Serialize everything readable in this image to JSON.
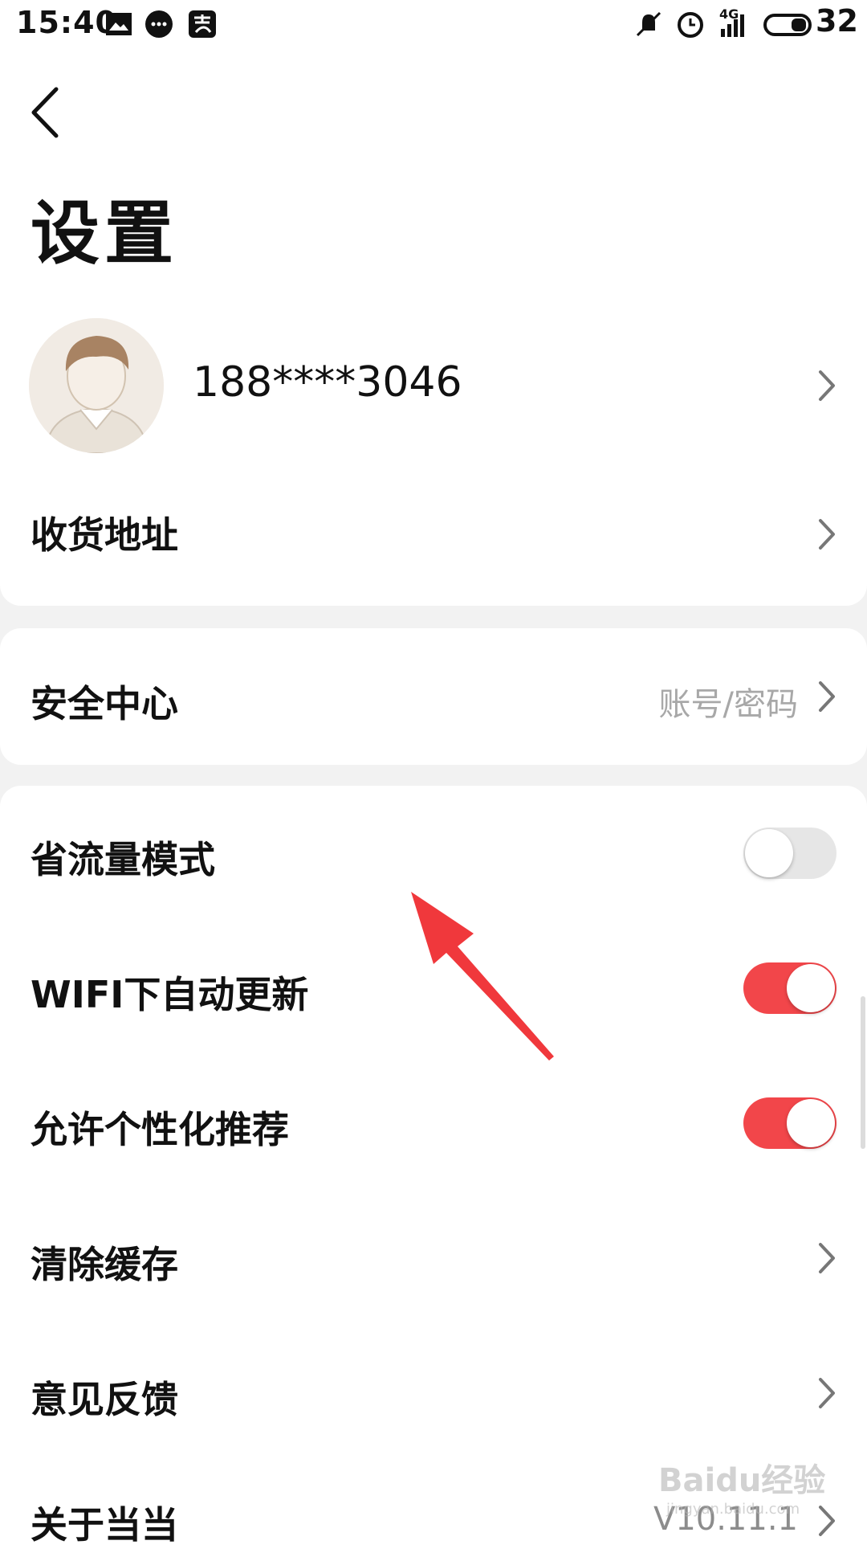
{
  "status_bar": {
    "time": "15:40",
    "left_icons": [
      "image-icon",
      "message-icon",
      "alipay-icon"
    ],
    "right_icons": [
      "mute-icon",
      "alarm-icon",
      "signal-4g-icon",
      "battery-icon"
    ],
    "network": "4G",
    "battery": "32"
  },
  "header": {
    "title": "设置"
  },
  "profile": {
    "phone": "188****3046"
  },
  "rows": {
    "address": {
      "label": "收货地址"
    },
    "security": {
      "label": "安全中心",
      "hint": "账号/密码"
    },
    "data_saver": {
      "label": "省流量模式",
      "enabled": false
    },
    "wifi_update": {
      "label": "WIFI下自动更新",
      "enabled": true
    },
    "personalized": {
      "label": "允许个性化推荐",
      "enabled": true
    },
    "clear_cache": {
      "label": "清除缓存"
    },
    "feedback": {
      "label": "意见反馈"
    },
    "about": {
      "label": "关于当当",
      "version": "V10.11.1"
    }
  },
  "watermark": {
    "text": "Baidu经验",
    "sub": "jingyan.baidu.com"
  },
  "colors": {
    "accent": "#f2464a",
    "annotation_arrow": "#f0383c",
    "background": "#f2f2f2"
  }
}
